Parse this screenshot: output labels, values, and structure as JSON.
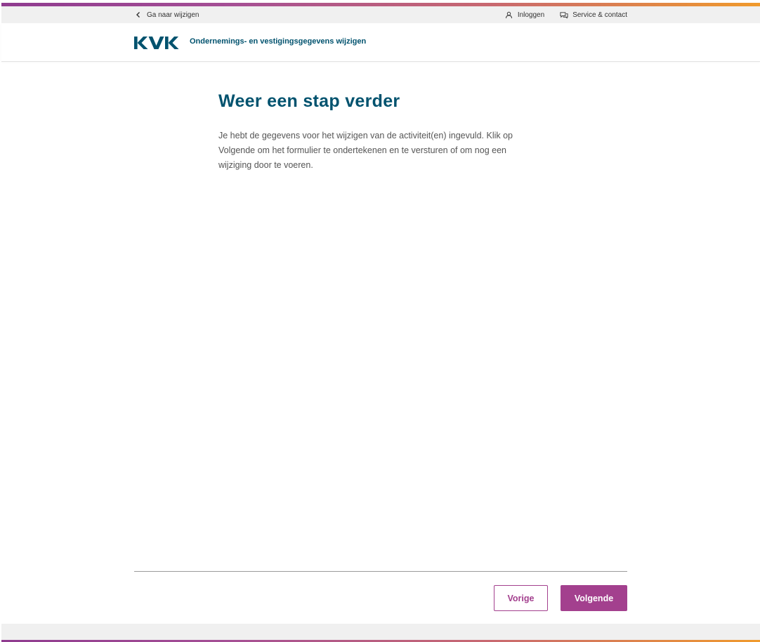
{
  "brand": {
    "logo_text": "KVK",
    "accent_purple": "#a3408e",
    "heading_blue": "#00526e"
  },
  "utility_bar": {
    "back_link": {
      "label": "Ga naar wijzigen",
      "icon": "chevron-left-icon"
    },
    "login": {
      "label": "Inloggen",
      "icon": "user-icon"
    },
    "service": {
      "label": "Service & contact",
      "icon": "chat-icon"
    }
  },
  "header": {
    "title": "Ondernemings- en vestigingsgegevens wijzigen"
  },
  "main": {
    "heading": "Weer een stap verder",
    "body": "Je hebt de gegevens voor het wijzigen van de activiteit(en) ingevuld. Klik op Volgende om het formulier te ondertekenen en te versturen of om nog een wijziging door te voeren."
  },
  "actions": {
    "previous_label": "Vorige",
    "next_label": "Volgende"
  }
}
